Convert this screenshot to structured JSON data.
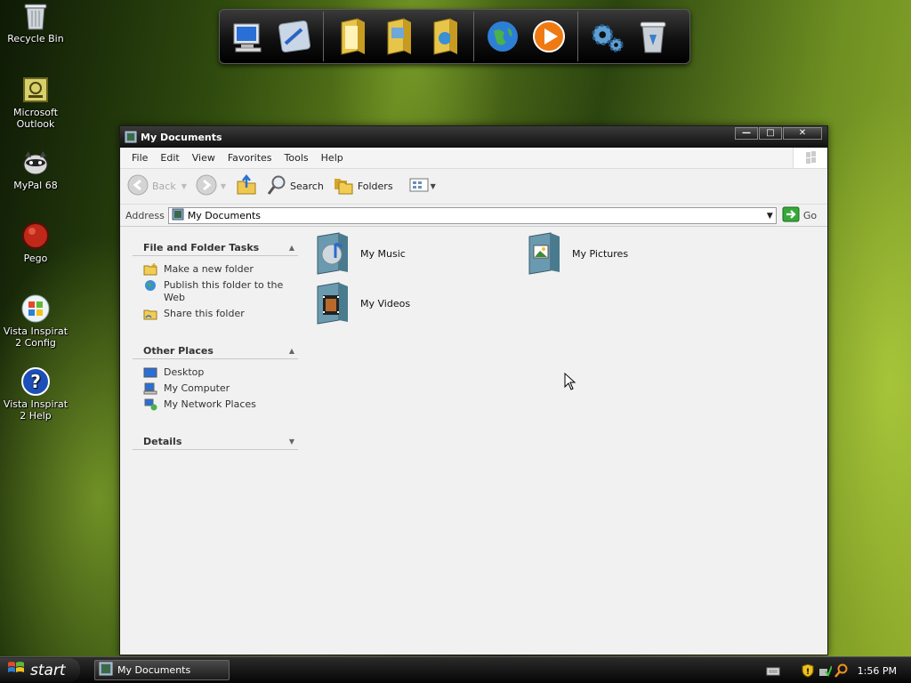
{
  "desktop": {
    "icons": [
      {
        "label": "Recycle Bin"
      },
      {
        "label": "Microsoft Outlook"
      },
      {
        "label": "MyPal 68"
      },
      {
        "label": "Pego"
      },
      {
        "label": "Vista Inspirat 2 Config"
      },
      {
        "label": "Vista Inspirat 2 Help"
      }
    ]
  },
  "dock": {
    "items": [
      "my-computer-icon",
      "control-panel-icon",
      "documents-folder-icon",
      "pictures-folder-icon",
      "network-folder-icon",
      "globe-icon",
      "media-player-icon",
      "settings-gears-icon",
      "recycle-bin-icon"
    ]
  },
  "window": {
    "title": "My Documents",
    "menu": [
      "File",
      "Edit",
      "View",
      "Favorites",
      "Tools",
      "Help"
    ],
    "toolbar": {
      "back": "Back",
      "search": "Search",
      "folders": "Folders"
    },
    "address": {
      "label": "Address",
      "value": "My Documents",
      "go": "Go"
    },
    "tasks": {
      "file_folder": {
        "title": "File and Folder Tasks",
        "items": [
          "Make a new folder",
          "Publish this folder to the Web",
          "Share this folder"
        ]
      },
      "other_places": {
        "title": "Other Places",
        "items": [
          "Desktop",
          "My Computer",
          "My Network Places"
        ]
      },
      "details": {
        "title": "Details"
      }
    },
    "folders": [
      "My Music",
      "My Pictures",
      "My Videos"
    ]
  },
  "taskbar": {
    "start": "start",
    "task_button": "My Documents",
    "clock": "1:56 PM"
  },
  "colors": {
    "title_bar": "#101010",
    "window_bg": "#f1f1f1",
    "taskbar": "#050505"
  }
}
